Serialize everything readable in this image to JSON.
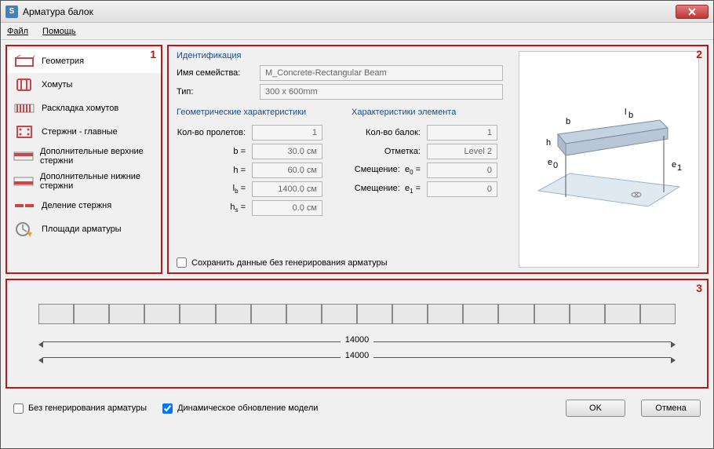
{
  "title": "Арматура балок",
  "menu": {
    "file": "Файл",
    "help": "Помощь"
  },
  "zones": {
    "one": "1",
    "two": "2",
    "three": "3"
  },
  "sidebar": {
    "items": [
      {
        "label": "Геометрия"
      },
      {
        "label": "Хомуты"
      },
      {
        "label": "Раскладка хомутов"
      },
      {
        "label": "Стержни - главные"
      },
      {
        "label": "Дополнительные верхние стержни"
      },
      {
        "label": "Дополнительные нижние стержни"
      },
      {
        "label": "Деление стержня"
      },
      {
        "label": "Площади арматуры"
      }
    ]
  },
  "ident": {
    "title": "Идентификация",
    "family_label": "Имя семейства:",
    "family_value": "M_Concrete-Rectangular Beam",
    "type_label": "Тип:",
    "type_value": "300 x 600mm"
  },
  "geom": {
    "title": "Геометрические характеристики",
    "spans_label": "Кол-во пролетов:",
    "spans_value": "1",
    "b_label": "b =",
    "b_value": "30.0 см",
    "h_label": "h =",
    "h_value": "60.0 см",
    "lb_value": "1400.0 см",
    "hs_value": "0.0 см"
  },
  "elem": {
    "title": "Характеристики элемента",
    "count_label": "Кол-во балок:",
    "count_value": "1",
    "level_label": "Отметка:",
    "level_value": "Level 2",
    "e0_label": "Смещение:",
    "e0_value": "0",
    "e1_label": "Смещение:",
    "e1_value": "0"
  },
  "save_chk": "Сохранить данные без генерирования арматуры",
  "dim": {
    "top": "14000",
    "bottom": "14000"
  },
  "footer": {
    "nogen": "Без генерирования арматуры",
    "dyn": "Динамическое обновление модели",
    "ok": "OK",
    "cancel": "Отмена"
  },
  "app_icon_letter": "S"
}
